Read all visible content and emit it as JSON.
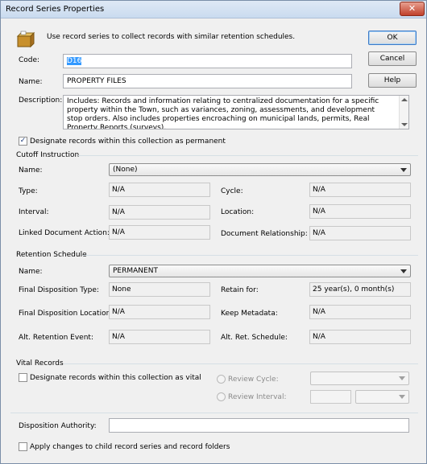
{
  "window": {
    "title": "Record Series Properties",
    "close_glyph": "✕"
  },
  "header": {
    "description": "Use record series to collect records with similar retention schedules.",
    "icon": "records-box-icon"
  },
  "buttons": {
    "ok": "OK",
    "cancel": "Cancel",
    "help": "Help"
  },
  "form": {
    "code_label": "Code:",
    "code_value": "D16",
    "name_label": "Name:",
    "name_value": "PROPERTY FILES",
    "description_label": "Description:",
    "description_value": "Includes: Records and information relating to centralized documentation for a specific property within the Town, such as variances, zoning, assessments, and development stop orders.  Also includes properties encroaching on municipal lands, permits, Real Property Reports (surveys),",
    "permanent_check": "Designate records within this collection as permanent",
    "permanent_checked": true,
    "check_glyph": "✓"
  },
  "cutoff": {
    "title": "Cutoff Instruction",
    "name_label": "Name:",
    "name_value": "(None)",
    "type_label": "Type:",
    "type_value": "N/A",
    "cycle_label": "Cycle:",
    "cycle_value": "N/A",
    "interval_label": "Interval:",
    "interval_value": "N/A",
    "location_label": "Location:",
    "location_value": "N/A",
    "linked_label": "Linked Document Action:",
    "linked_value": "N/A",
    "relationship_label": "Document Relationship:",
    "relationship_value": "N/A"
  },
  "retention": {
    "title": "Retention Schedule",
    "name_label": "Name:",
    "name_value": "PERMANENT",
    "final_type_label": "Final Disposition Type:",
    "final_type_value": "None",
    "retain_label": "Retain for:",
    "retain_value": "25 year(s), 0 month(s)",
    "final_location_label": "Final Disposition Location:",
    "final_location_value": "N/A",
    "keep_metadata_label": "Keep Metadata:",
    "keep_metadata_value": "N/A",
    "alt_event_label": "Alt. Retention Event:",
    "alt_event_value": "N/A",
    "alt_schedule_label": "Alt. Ret. Schedule:",
    "alt_schedule_value": "N/A"
  },
  "vital": {
    "title": "Vital Records",
    "vital_check": "Designate records within this collection as vital",
    "review_cycle_label": "Review Cycle:",
    "review_interval_label": "Review Interval:"
  },
  "disposition": {
    "label": "Disposition Authority:",
    "value": ""
  },
  "apply": {
    "label": "Apply changes to child record series and record folders"
  }
}
